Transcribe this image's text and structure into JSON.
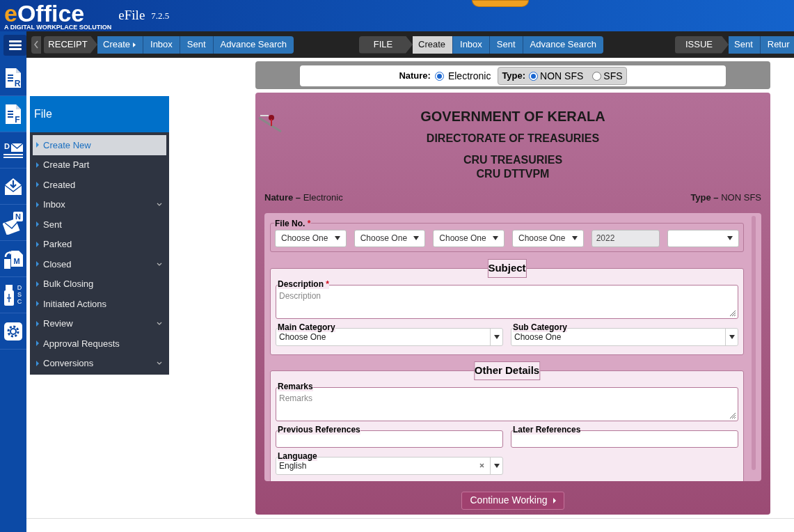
{
  "header": {
    "logo_initial": "e",
    "logo_rest": "Office",
    "tagline": "A DIGITAL WORKPLACE SOLUTION",
    "app_name": "eFile",
    "version": "7.2.5"
  },
  "nav_groups": [
    {
      "label": "RECEIPT",
      "items": [
        {
          "label": "Create",
          "has_caret": true,
          "selected": false
        },
        {
          "label": "Inbox",
          "has_caret": false,
          "selected": false
        },
        {
          "label": "Sent",
          "has_caret": false,
          "selected": false
        },
        {
          "label": "Advance Search",
          "has_caret": false,
          "selected": false
        }
      ]
    },
    {
      "label": "FILE",
      "items": [
        {
          "label": "Create",
          "has_caret": false,
          "selected": true
        },
        {
          "label": "Inbox",
          "has_caret": false,
          "selected": false
        },
        {
          "label": "Sent",
          "has_caret": false,
          "selected": false
        },
        {
          "label": "Advance Search",
          "has_caret": false,
          "selected": false
        }
      ]
    },
    {
      "label": "ISSUE",
      "items": [
        {
          "label": "Sent",
          "has_caret": false,
          "selected": false
        },
        {
          "label": "Retur",
          "has_caret": false,
          "selected": false
        }
      ]
    }
  ],
  "rail": [
    {
      "kind": "doc",
      "letter": "R",
      "selected": false
    },
    {
      "kind": "doc",
      "letter": "F",
      "selected": true
    },
    {
      "kind": "envelope",
      "letter": "D",
      "selected": false
    },
    {
      "kind": "inbox",
      "selected": false
    },
    {
      "kind": "envelope-badge",
      "letter": "N",
      "selected": false
    },
    {
      "kind": "move",
      "letter": "M",
      "selected": false
    },
    {
      "kind": "usb",
      "letter": "DSC",
      "selected": false
    },
    {
      "kind": "settings",
      "selected": false
    }
  ],
  "menu": {
    "title": "File",
    "items": [
      {
        "label": "Create New",
        "selected": true,
        "expandable": false
      },
      {
        "label": "Create Part",
        "selected": false,
        "expandable": false
      },
      {
        "label": "Created",
        "selected": false,
        "expandable": false
      },
      {
        "label": "Inbox",
        "selected": false,
        "expandable": true
      },
      {
        "label": "Sent",
        "selected": false,
        "expandable": false
      },
      {
        "label": "Parked",
        "selected": false,
        "expandable": false
      },
      {
        "label": "Closed",
        "selected": false,
        "expandable": true
      },
      {
        "label": "Bulk Closing",
        "selected": false,
        "expandable": false
      },
      {
        "label": "Initiated Actions",
        "selected": false,
        "expandable": false
      },
      {
        "label": "Review",
        "selected": false,
        "expandable": true
      },
      {
        "label": "Approval Requests",
        "selected": false,
        "expandable": false
      },
      {
        "label": "Conversions",
        "selected": false,
        "expandable": true
      }
    ]
  },
  "nature_bar": {
    "nature_label": "Nature:",
    "nature_options": [
      {
        "label": "Electronic",
        "selected": true
      }
    ],
    "type_label": "Type:",
    "type_options": [
      {
        "label": "NON SFS",
        "selected": true
      },
      {
        "label": "SFS",
        "selected": false
      }
    ]
  },
  "form": {
    "headings": [
      "GOVERNMENT OF KERALA",
      "DIRECTORATE OF TREASURIES",
      "CRU TREASURIES",
      "CRU DTTVPM"
    ],
    "nature_summary": {
      "label": "Nature –",
      "value": "Electronic"
    },
    "type_summary": {
      "label": "Type –",
      "value": "NON SFS"
    },
    "file_no": {
      "label": "File No.",
      "required_mark": "*",
      "fields": [
        {
          "kind": "select",
          "value": "Choose One"
        },
        {
          "kind": "select",
          "value": "Choose One"
        },
        {
          "kind": "select",
          "value": "Choose One"
        },
        {
          "kind": "select",
          "value": "Choose One"
        },
        {
          "kind": "readonly",
          "value": "2022"
        },
        {
          "kind": "select"
        }
      ]
    },
    "subject": {
      "title": "Subject",
      "description": {
        "label": "Description",
        "required_mark": "*",
        "placeholder": "Description"
      },
      "main_category": {
        "label": "Main Category",
        "value": "Choose One"
      },
      "sub_category": {
        "label": "Sub Category",
        "value": "Choose One"
      }
    },
    "other_details": {
      "title": "Other Details",
      "remarks": {
        "label": "Remarks",
        "placeholder": "Remarks"
      },
      "previous_references": {
        "label": "Previous References"
      },
      "later_references": {
        "label": "Later References"
      },
      "language": {
        "label": "Language",
        "value": "English",
        "clearable": true
      }
    },
    "button": "Continue Working"
  }
}
